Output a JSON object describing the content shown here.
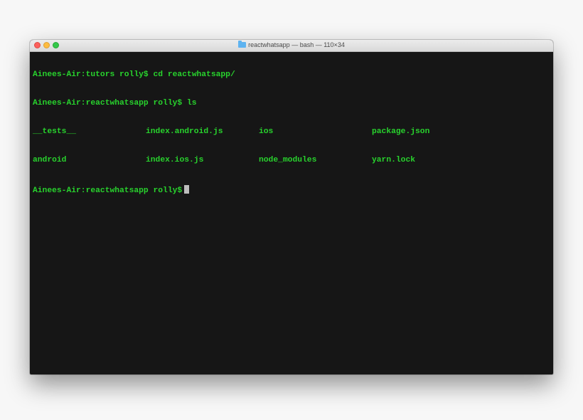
{
  "window": {
    "title": "reactwhatsapp — bash — 110×34",
    "title_icon": "folder-icon"
  },
  "terminal": {
    "text_color": "#28d32d",
    "background": "#161616",
    "commands": [
      "Ainees-Air:tutors rolly$ cd reactwhatsapp/",
      "Ainees-Air:reactwhatsapp rolly$ ls"
    ],
    "listing": [
      [
        "__tests__",
        "index.android.js",
        "ios",
        "package.json"
      ],
      [
        "android",
        "index.ios.js",
        "node_modules",
        "yarn.lock"
      ]
    ],
    "prompt": "Ainees-Air:reactwhatsapp rolly$"
  }
}
